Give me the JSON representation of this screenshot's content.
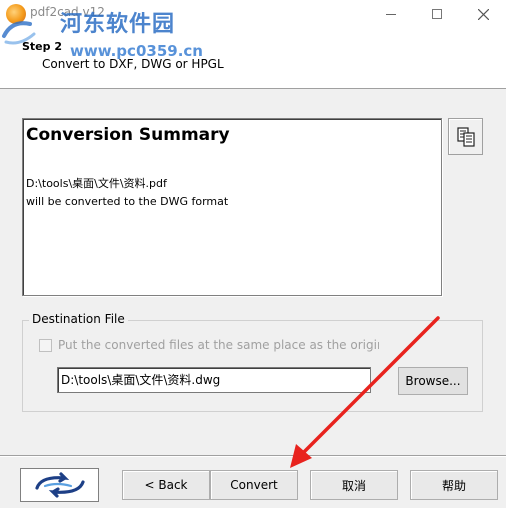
{
  "window": {
    "title": "pdf2cad v12",
    "controls": {
      "minimize": "minimize",
      "maximize": "maximize",
      "close": "close"
    }
  },
  "watermark": {
    "text": "河东软件园",
    "url": "www.pc0359.cn"
  },
  "header": {
    "step": "Step 2",
    "subtitle": "Convert to DXF, DWG or HPGL"
  },
  "summary": {
    "title": "Conversion Summary",
    "source_path": "D:\\tools\\桌面\\文件\\资料.pdf",
    "format_line": "will be converted to the DWG format"
  },
  "destination": {
    "legend": "Destination File",
    "same_place_label": "Put the converted files at the same place as the origina",
    "same_place_checked": false,
    "path_value": "D:\\tools\\桌面\\文件\\资料.dwg",
    "browse_label": "Browse..."
  },
  "footer": {
    "back_label": "< Back",
    "convert_label": "Convert",
    "cancel_label": "取消",
    "help_label": "帮助"
  },
  "colors": {
    "accent_arrow": "#e8231e",
    "watermark_blue": "#2d6fc5"
  },
  "icons": {
    "app": "pdf2cad-app-icon",
    "copy": "copy-clipboard-icon",
    "logo": "swoosh-logo-icon"
  }
}
